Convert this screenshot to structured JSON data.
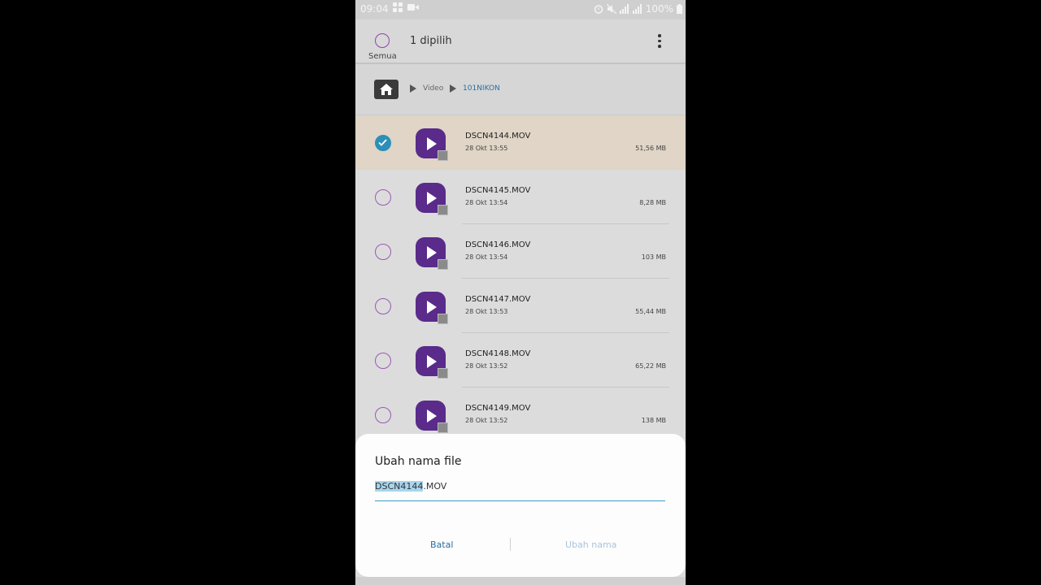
{
  "status_bar": {
    "time": "09:04",
    "battery": "100%",
    "icons_left": [
      "grid-icon",
      "video-record-icon"
    ],
    "icons_right": [
      "alarm-icon",
      "mute-icon",
      "signal-icon",
      "signal2-icon",
      "battery-icon"
    ]
  },
  "header": {
    "select_all_label": "Semua",
    "selected_count": "1 dipilih"
  },
  "breadcrumb": {
    "items": [
      "Video",
      "101NIKON"
    ]
  },
  "files": [
    {
      "name": "DSCN4144.MOV",
      "date": "28 Okt 13:55",
      "size": "51,56 MB",
      "selected": true
    },
    {
      "name": "DSCN4145.MOV",
      "date": "28 Okt 13:54",
      "size": "8,28 MB",
      "selected": false
    },
    {
      "name": "DSCN4146.MOV",
      "date": "28 Okt 13:54",
      "size": "103 MB",
      "selected": false
    },
    {
      "name": "DSCN4147.MOV",
      "date": "28 Okt 13:53",
      "size": "55,44 MB",
      "selected": false
    },
    {
      "name": "DSCN4148.MOV",
      "date": "28 Okt 13:52",
      "size": "65,22 MB",
      "selected": false
    },
    {
      "name": "DSCN4149.MOV",
      "date": "28 Okt 13:52",
      "size": "138 MB",
      "selected": false
    }
  ],
  "dialog": {
    "title": "Ubah nama file",
    "input_selected": "DSCN4144",
    "input_rest": ".MOV",
    "cancel_label": "Batal",
    "rename_label": "Ubah nama"
  },
  "colors": {
    "accent": "#5a2b8a",
    "check_selected": "#2b8fb8",
    "link": "#2a6fa3",
    "disabled_link": "#a9c4dc"
  }
}
